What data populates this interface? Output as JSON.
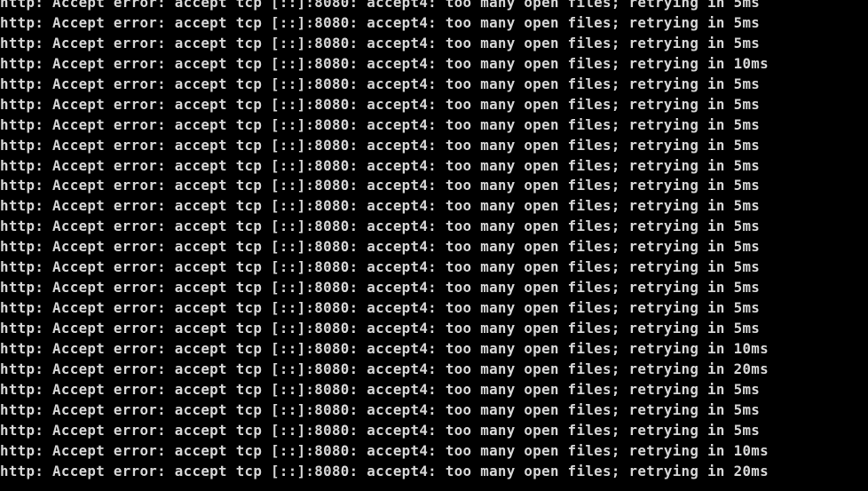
{
  "terminal": {
    "colors": {
      "background": "#000000",
      "text": "#d8d8d8"
    },
    "lines": [
      "http: Accept error: accept tcp [::]:8080: accept4: too many open files; retrying in 5ms",
      "http: Accept error: accept tcp [::]:8080: accept4: too many open files; retrying in 5ms",
      "http: Accept error: accept tcp [::]:8080: accept4: too many open files; retrying in 5ms",
      "http: Accept error: accept tcp [::]:8080: accept4: too many open files; retrying in 10ms",
      "http: Accept error: accept tcp [::]:8080: accept4: too many open files; retrying in 5ms",
      "http: Accept error: accept tcp [::]:8080: accept4: too many open files; retrying in 5ms",
      "http: Accept error: accept tcp [::]:8080: accept4: too many open files; retrying in 5ms",
      "http: Accept error: accept tcp [::]:8080: accept4: too many open files; retrying in 5ms",
      "http: Accept error: accept tcp [::]:8080: accept4: too many open files; retrying in 5ms",
      "http: Accept error: accept tcp [::]:8080: accept4: too many open files; retrying in 5ms",
      "http: Accept error: accept tcp [::]:8080: accept4: too many open files; retrying in 5ms",
      "http: Accept error: accept tcp [::]:8080: accept4: too many open files; retrying in 5ms",
      "http: Accept error: accept tcp [::]:8080: accept4: too many open files; retrying in 5ms",
      "http: Accept error: accept tcp [::]:8080: accept4: too many open files; retrying in 5ms",
      "http: Accept error: accept tcp [::]:8080: accept4: too many open files; retrying in 5ms",
      "http: Accept error: accept tcp [::]:8080: accept4: too many open files; retrying in 5ms",
      "http: Accept error: accept tcp [::]:8080: accept4: too many open files; retrying in 5ms",
      "http: Accept error: accept tcp [::]:8080: accept4: too many open files; retrying in 10ms",
      "http: Accept error: accept tcp [::]:8080: accept4: too many open files; retrying in 20ms",
      "http: Accept error: accept tcp [::]:8080: accept4: too many open files; retrying in 5ms",
      "http: Accept error: accept tcp [::]:8080: accept4: too many open files; retrying in 5ms",
      "http: Accept error: accept tcp [::]:8080: accept4: too many open files; retrying in 5ms",
      "http: Accept error: accept tcp [::]:8080: accept4: too many open files; retrying in 10ms",
      "http: Accept error: accept tcp [::]:8080: accept4: too many open files; retrying in 20ms"
    ]
  }
}
